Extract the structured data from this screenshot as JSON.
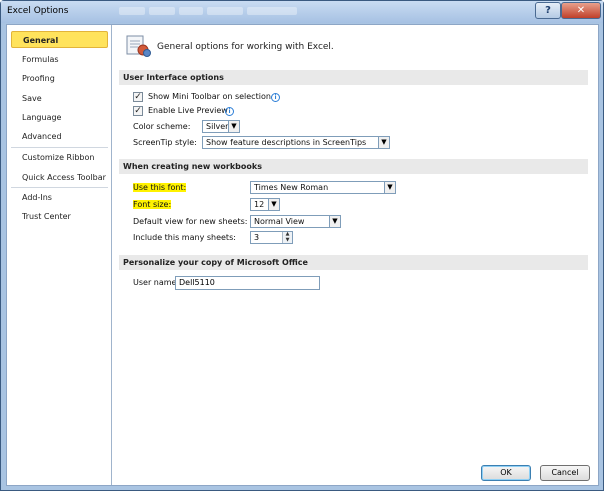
{
  "window": {
    "title": "Excel Options",
    "help_glyph": "?",
    "close_glyph": "✕"
  },
  "nav": {
    "items": [
      {
        "label": "General"
      },
      {
        "label": "Formulas"
      },
      {
        "label": "Proofing"
      },
      {
        "label": "Save"
      },
      {
        "label": "Language"
      },
      {
        "label": "Advanced"
      },
      {
        "label": "Customize Ribbon"
      },
      {
        "label": "Quick Access Toolbar"
      },
      {
        "label": "Add-Ins"
      },
      {
        "label": "Trust Center"
      }
    ],
    "selected": "General"
  },
  "content": {
    "header": "General options for working with Excel.",
    "ui_section": {
      "title": "User Interface options",
      "show_mini_toolbar": {
        "label": "Show Mini Toolbar on selection",
        "checked": true
      },
      "enable_live_preview": {
        "label": "Enable Live Preview",
        "checked": true
      },
      "color_scheme": {
        "label": "Color scheme:",
        "value": "Silver"
      },
      "screentip_style": {
        "label": "ScreenTip style:",
        "value": "Show feature descriptions in ScreenTips"
      }
    },
    "new_workbooks_section": {
      "title": "When creating new workbooks",
      "font": {
        "label": "Use this font:",
        "value": "Times New Roman"
      },
      "font_size": {
        "label": "Font size:",
        "value": "12"
      },
      "default_view": {
        "label": "Default view for new sheets:",
        "value": "Normal View"
      },
      "sheet_count": {
        "label": "Include this many sheets:",
        "value": "3"
      }
    },
    "personalize_section": {
      "title": "Personalize your copy of Microsoft Office",
      "user_name": {
        "label": "User name:",
        "value": "Dell5110"
      }
    }
  },
  "footer": {
    "ok_label": "OK",
    "cancel_label": "Cancel"
  },
  "colors": {
    "selection": "#ffe35c",
    "highlight": "#fff200",
    "title_bar": "#a9c4e2",
    "close_button": "#c0402a"
  },
  "icons": {
    "check": "✓",
    "dropdown": "▼",
    "spin_up": "▲",
    "spin_down": "▼",
    "info": "i"
  }
}
